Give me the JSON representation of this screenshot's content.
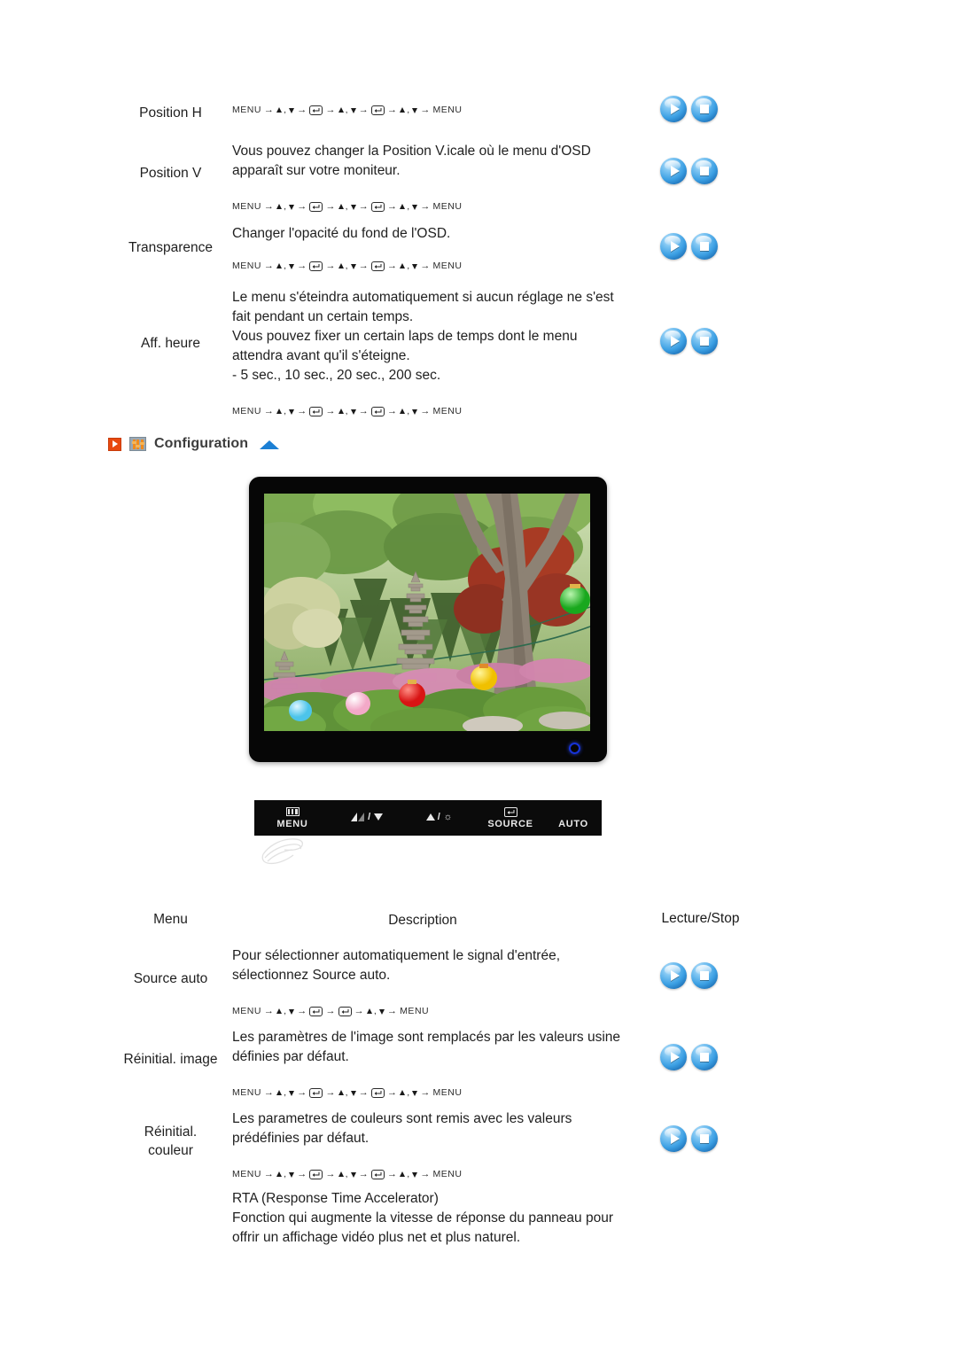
{
  "top_table": {
    "rows": [
      {
        "menu": "Position H",
        "description": [],
        "nav": [
          "MENU",
          "updown",
          "enter",
          "updown",
          "enter",
          "updown",
          "MENU"
        ]
      },
      {
        "menu": "Position V",
        "description": [
          "Vous pouvez changer la Position V.icale où le menu d'OSD",
          "apparaît sur votre moniteur."
        ],
        "nav": [
          "MENU",
          "updown",
          "enter",
          "updown",
          "enter",
          "updown",
          "MENU"
        ]
      },
      {
        "menu": "Transparence",
        "description": [
          "Changer l'opacité du fond de l'OSD."
        ],
        "nav": [
          "MENU",
          "updown",
          "enter",
          "updown",
          "enter",
          "updown",
          "MENU"
        ]
      },
      {
        "menu": "Aff. heure",
        "description": [
          "Le menu s'éteindra automatiquement si aucun réglage ne s'est",
          "fait pendant un certain temps.",
          "Vous pouvez fixer un certain laps de temps dont le menu",
          "attendra avant qu'il s'éteigne.",
          "- 5 sec., 10 sec., 20 sec., 200 sec."
        ],
        "nav": [
          "MENU",
          "updown",
          "enter",
          "updown",
          "enter",
          "updown",
          "MENU"
        ]
      }
    ]
  },
  "section": {
    "title": "Configuration",
    "play_icon": "play-square-icon",
    "sliders_icon": "sliders-icon",
    "collapse_icon": "triangle-up-icon"
  },
  "monitor": {
    "screen_alt": "garden-photo-with-stone-pagoda-and-paper-lanterns",
    "power_led": "power-led-indicator"
  },
  "control_bar": {
    "buttons": [
      {
        "label": "MENU",
        "glyph": "menu-icon"
      },
      {
        "label": "",
        "glyph": "contrast-down-icon"
      },
      {
        "label": "",
        "glyph": "up-brightness-icon"
      },
      {
        "label": "SOURCE",
        "glyph": "enter-icon"
      },
      {
        "label": "AUTO",
        "glyph": ""
      }
    ],
    "hand_cursor": "hand-pointer-graphic"
  },
  "bottom_table": {
    "headers": {
      "menu": "Menu",
      "description": "Description",
      "playstop": "Lecture/Stop"
    },
    "rows": [
      {
        "menu": "Source auto",
        "description": [
          "Pour sélectionner automatiquement le signal d'entrée,",
          "sélectionnez Source auto."
        ],
        "nav": [
          "MENU",
          "updown",
          "enter",
          "enter",
          "updown",
          "MENU"
        ]
      },
      {
        "menu": "Réinitial. image",
        "description": [
          "Les paramètres de l'image sont remplacés par les valeurs usine",
          "définies par défaut."
        ],
        "nav": [
          "MENU",
          "updown",
          "enter",
          "updown",
          "enter",
          "updown",
          "MENU"
        ]
      },
      {
        "menu": "Réinitial.\ncouleur",
        "description": [
          "Les parametres de couleurs sont remis avec les valeurs",
          "prédéfinies par défaut."
        ],
        "nav": [
          "MENU",
          "updown",
          "enter",
          "updown",
          "enter",
          "updown",
          "MENU"
        ]
      },
      {
        "menu": "",
        "description": [
          "RTA (Response Time Accelerator)",
          "Fonction qui augmente la vitesse de réponse du panneau pour",
          "offrir un affichage vidéo plus net et plus naturel."
        ],
        "nav": []
      }
    ]
  },
  "labels": {
    "menu_word": "MENU",
    "play_button": "Lecture",
    "stop_button": "Stop"
  }
}
